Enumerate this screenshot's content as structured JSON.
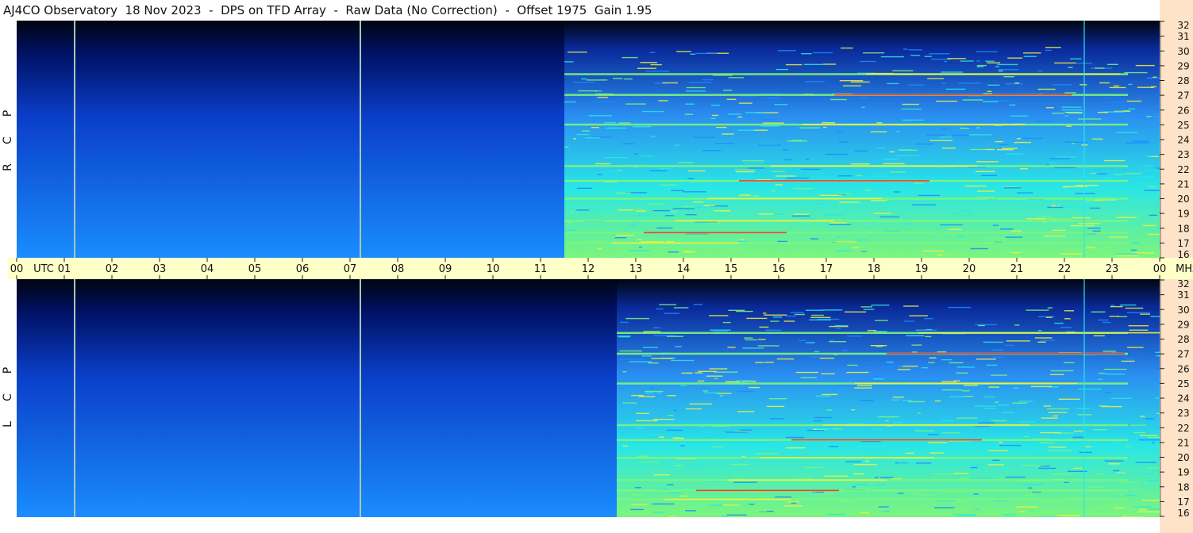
{
  "window": {
    "title": "AJ4CO Observatory  18 Nov 2023  -  DPS on TFD Array  -  Raw Data (No Correction)  -  Offset 1975  Gain 1.95"
  },
  "panels": [
    {
      "id": "rcp",
      "label_letters": [
        "R",
        "C",
        "P"
      ]
    },
    {
      "id": "lcp",
      "label_letters": [
        "L",
        "C",
        "P"
      ]
    }
  ],
  "colors": {
    "background_dark": "#000510",
    "low": "#0a3ec8",
    "mid": "#1a8cff",
    "cyan": "#29e6e6",
    "green": "#7cf57c",
    "yellow": "#f0f040",
    "red": "#ff3030",
    "marker_line": "#a8c8b0",
    "utc_bar": "#ffffc8",
    "freq_strip": "#ffe3c8"
  },
  "chart_data": {
    "type": "heatmap",
    "title": "AJ4CO Observatory  18 Nov 2023  -  DPS on TFD Array  -  Raw Data (No Correction)  -  Offset 1975  Gain 1.95",
    "x_axis": {
      "unit_label": "UTC",
      "range_hours": [
        0,
        24
      ],
      "tick_labels": [
        "00",
        "01",
        "02",
        "03",
        "04",
        "05",
        "06",
        "07",
        "08",
        "09",
        "10",
        "11",
        "12",
        "13",
        "14",
        "15",
        "16",
        "17",
        "18",
        "19",
        "20",
        "21",
        "22",
        "23",
        "00"
      ]
    },
    "y_axis": {
      "unit_label": "MHz",
      "range_mhz": [
        16,
        32
      ],
      "tick_labels": [
        "16",
        "17",
        "18",
        "19",
        "20",
        "21",
        "22",
        "23",
        "24",
        "25",
        "26",
        "27",
        "28",
        "29",
        "30",
        "31",
        "32"
      ]
    },
    "marker_lines_utc": [
      1.2,
      7.2
    ],
    "series": [
      {
        "name": "RCP",
        "day_onset_utc": 11.5,
        "persistent_lines_mhz": [
          17.0,
          17.7,
          18.5,
          20.0,
          21.2,
          22.2,
          25.0,
          27.0,
          28.4
        ],
        "vertical_feature_utc": 22.4
      },
      {
        "name": "LCP",
        "day_onset_utc": 12.6,
        "persistent_lines_mhz": [
          17.2,
          17.8,
          18.5,
          20.0,
          21.2,
          22.2,
          25.0,
          27.0,
          28.4
        ],
        "vertical_feature_utc": 22.4
      }
    ]
  }
}
